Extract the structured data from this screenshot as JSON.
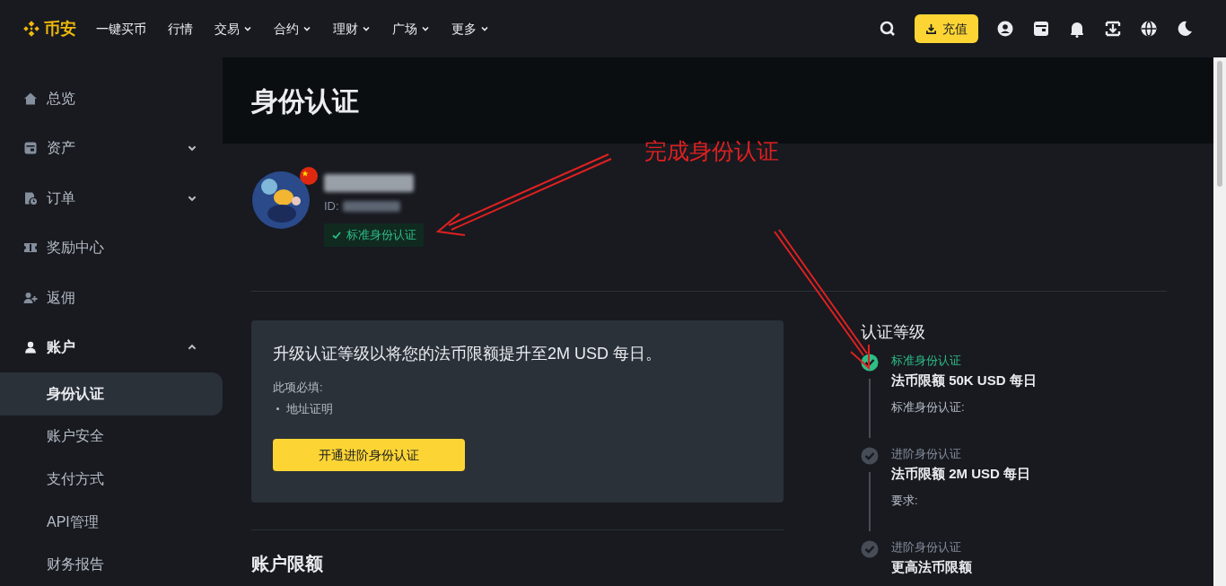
{
  "brand": {
    "name": "币安"
  },
  "nav": [
    {
      "label": "一键买币",
      "dropdown": false
    },
    {
      "label": "行情",
      "dropdown": false
    },
    {
      "label": "交易",
      "dropdown": true
    },
    {
      "label": "合约",
      "dropdown": true
    },
    {
      "label": "理财",
      "dropdown": true
    },
    {
      "label": "广场",
      "dropdown": true
    },
    {
      "label": "更多",
      "dropdown": true
    }
  ],
  "deposit_button": {
    "label": "充值"
  },
  "sidebar": {
    "items": [
      {
        "label": "总览"
      },
      {
        "label": "资产",
        "expanded": false
      },
      {
        "label": "订单",
        "expanded": false
      },
      {
        "label": "奖励中心"
      },
      {
        "label": "返佣"
      },
      {
        "label": "账户",
        "expanded": true,
        "children": [
          {
            "label": "身份认证",
            "selected": true
          },
          {
            "label": "账户安全",
            "selected": false
          },
          {
            "label": "支付方式",
            "selected": false
          },
          {
            "label": "API管理",
            "selected": false
          },
          {
            "label": "财务报告",
            "selected": false
          }
        ]
      }
    ]
  },
  "page_title": "身份认证",
  "profile": {
    "id_label": "ID:",
    "badge": "标准身份认证"
  },
  "upgrade_card": {
    "title": "升级认证等级以将您的法币限额提升至2M USD 每日。",
    "required_label": "此项必填:",
    "requirements": [
      "地址证明"
    ],
    "button": "开通进阶身份认证"
  },
  "limits_heading": "账户限额",
  "levels": {
    "title": "认证等级",
    "items": [
      {
        "name": "标准身份认证",
        "done": true,
        "limit": "法币限额 50K USD 每日",
        "note": "标准身份认证:"
      },
      {
        "name": "进阶身份认证",
        "done": false,
        "limit": "法币限额 2M USD 每日",
        "note": "要求:"
      },
      {
        "name": "进阶身份认证",
        "done": false,
        "limit": "更高法币限额"
      }
    ]
  },
  "annotation": {
    "text": "完成身份认证"
  }
}
